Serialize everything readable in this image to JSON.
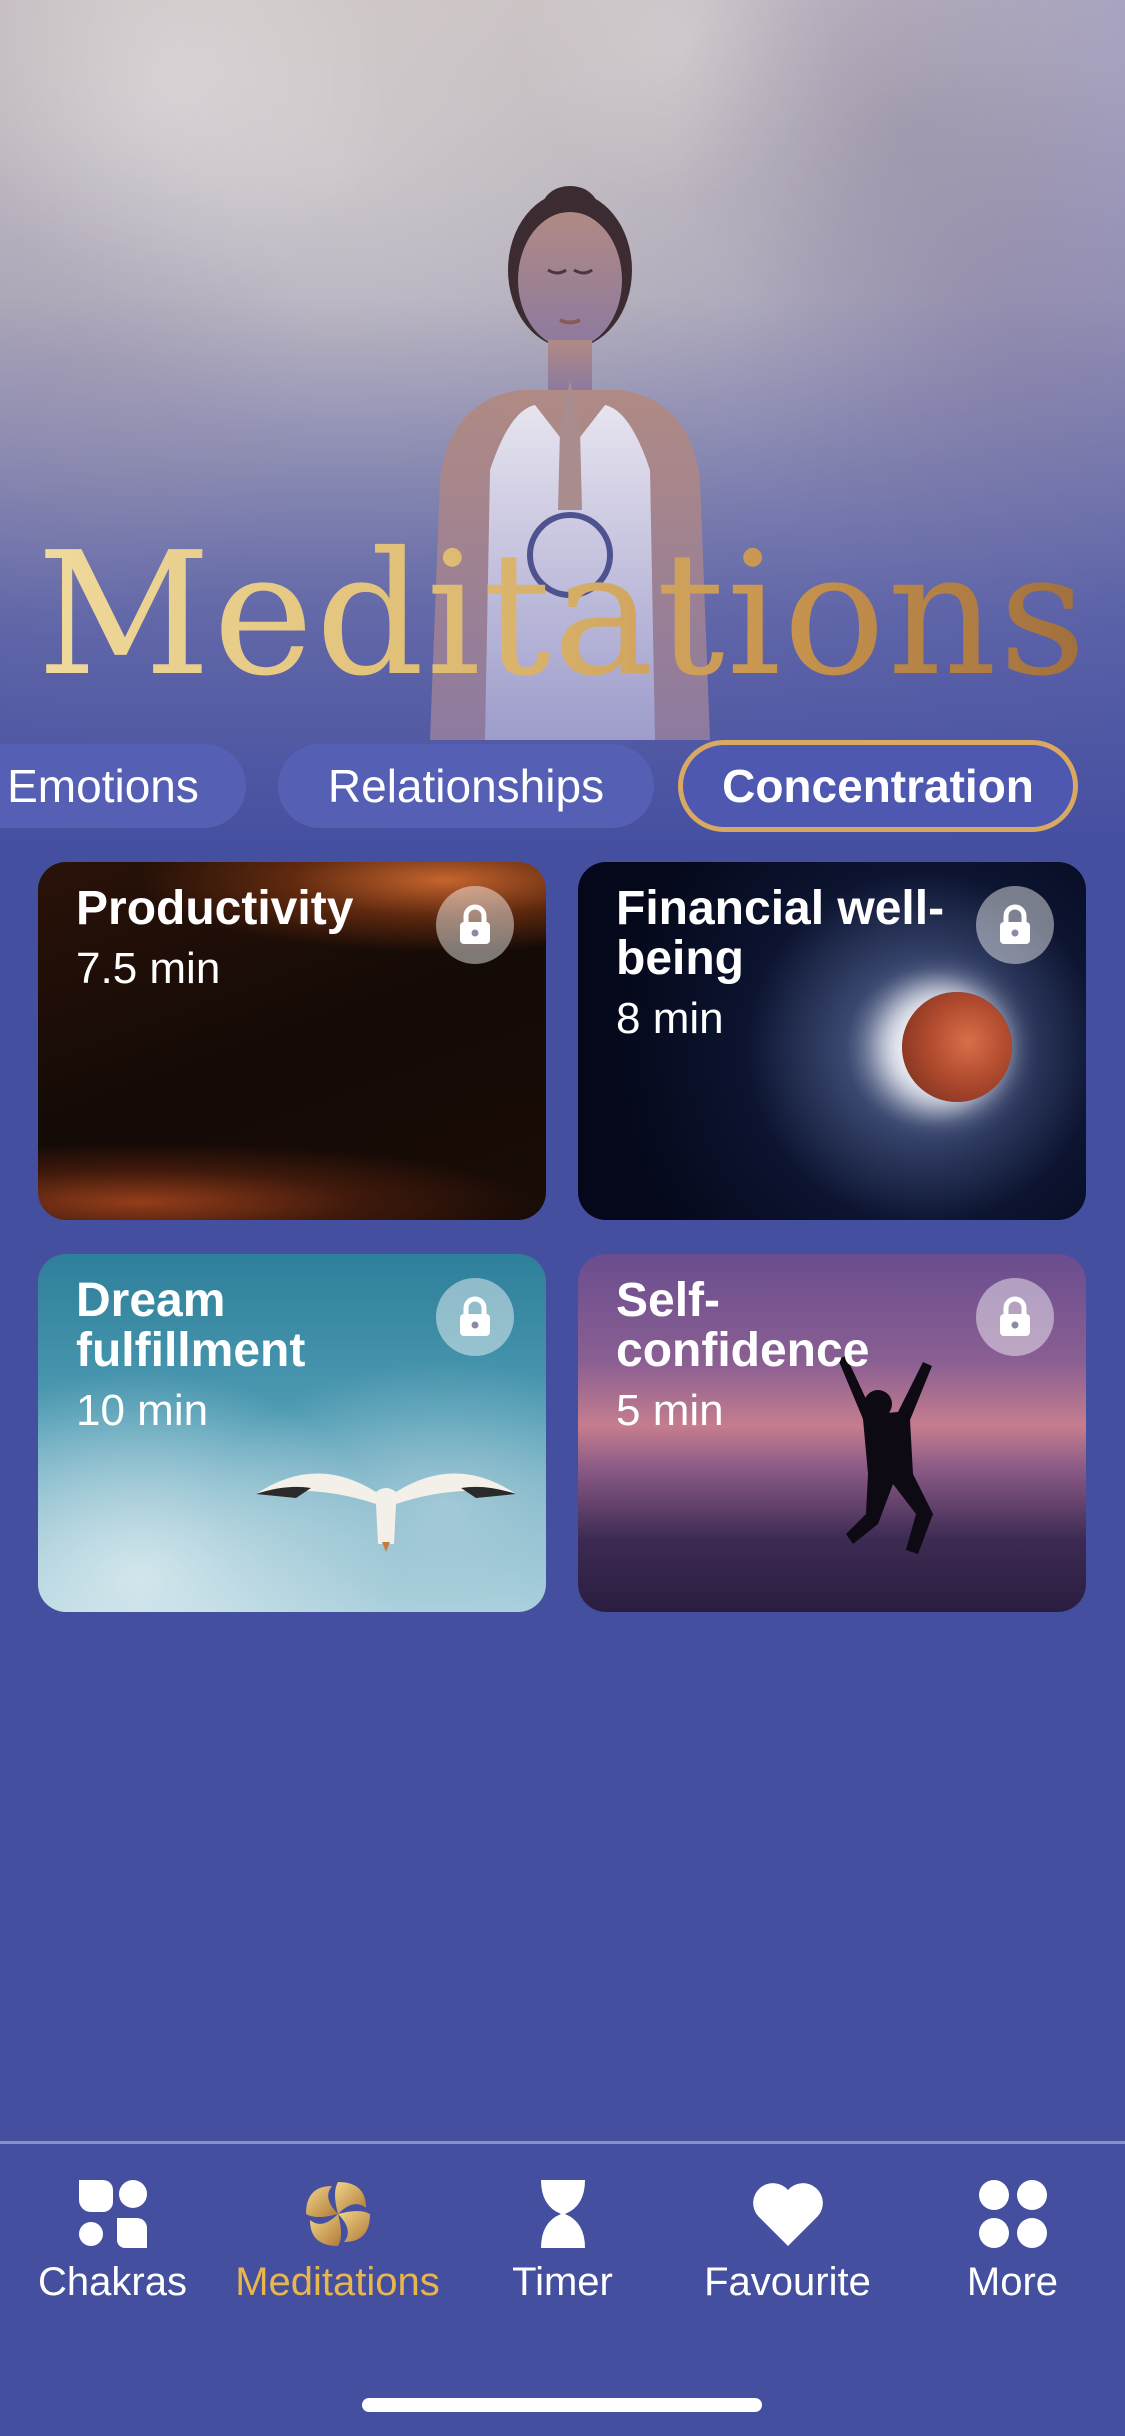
{
  "hero": {
    "title": "Meditations"
  },
  "tabs": [
    {
      "label": "Emotions"
    },
    {
      "label": "Relationships"
    },
    {
      "label": "Concentration"
    }
  ],
  "active_tab": "Concentration",
  "cards": [
    {
      "title": "Productivity",
      "duration": "7.5 min",
      "locked": true,
      "icon": "lock-icon"
    },
    {
      "title": "Financial well-being",
      "duration": "8 min",
      "locked": true,
      "icon": "lock-icon"
    },
    {
      "title": "Dream fulfillment",
      "duration": "10 min",
      "locked": true,
      "icon": "lock-icon"
    },
    {
      "title": "Self-confidence",
      "duration": "5 min",
      "locked": true,
      "icon": "lock-icon"
    }
  ],
  "nav": {
    "items": [
      {
        "label": "Chakras",
        "icon": "chakras-icon"
      },
      {
        "label": "Meditations",
        "icon": "meditations-icon"
      },
      {
        "label": "Timer",
        "icon": "hourglass-icon"
      },
      {
        "label": "Favourite",
        "icon": "heart-icon"
      },
      {
        "label": "More",
        "icon": "more-grid-icon"
      }
    ],
    "active": "Meditations"
  },
  "colors": {
    "background": "#454fa0",
    "accent_gold": "#d9a961",
    "active_nav": "#e9b64d"
  }
}
